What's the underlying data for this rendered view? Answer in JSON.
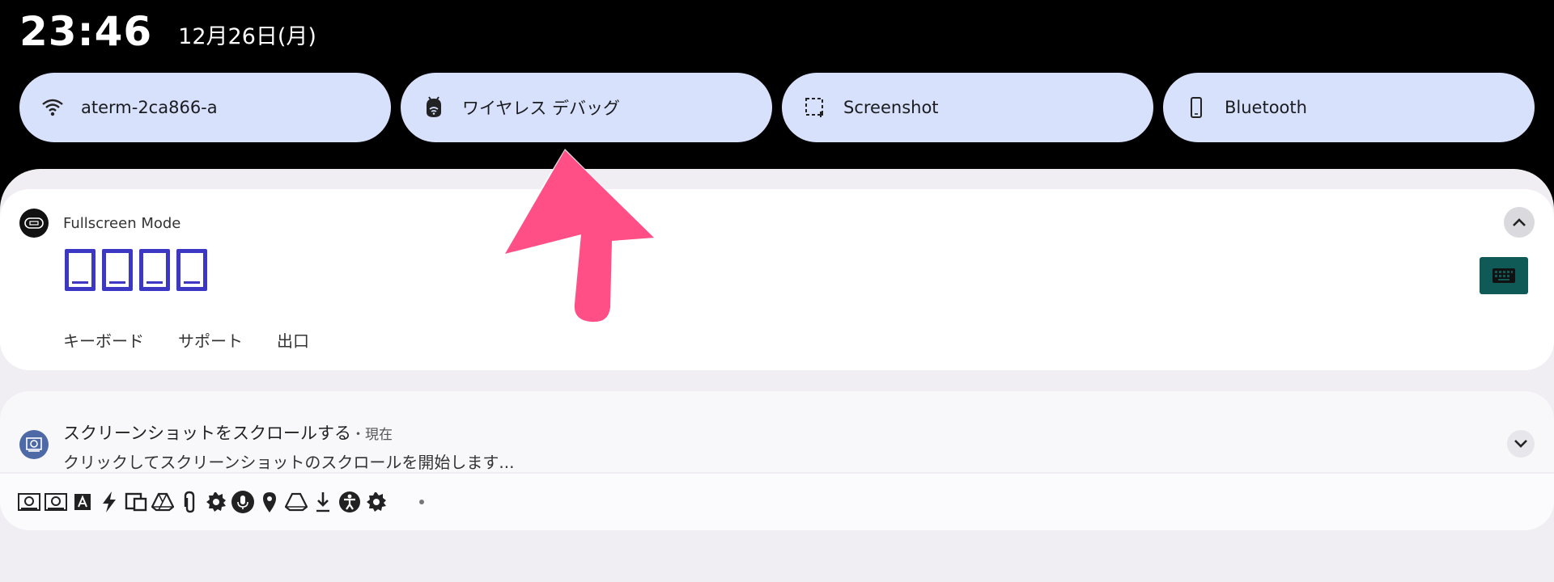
{
  "status": {
    "time": "23:46",
    "date": "12月26日(月)"
  },
  "tiles": [
    {
      "label": "aterm-2ca866-a",
      "icon": "wifi-icon"
    },
    {
      "label": "ワイヤレス デバッグ",
      "icon": "android-debug-icon"
    },
    {
      "label": "Screenshot",
      "icon": "screenshot-icon"
    },
    {
      "label": "Bluetooth",
      "icon": "phone-icon"
    }
  ],
  "notification1": {
    "app": "Fullscreen Mode",
    "icon": "fullscreen-mode-app-icon",
    "actions": [
      "キーボード",
      "サポート",
      "出口"
    ]
  },
  "notification2": {
    "title": "スクリーンショットをスクロールする",
    "time": "・現在",
    "body": "クリックしてスクリーンショットのスクロールを開始します..."
  },
  "colors": {
    "tile_bg": "#d8e1fb",
    "glyph": "#3d38c4",
    "keyboard_button": "#0f5a56",
    "arrow": "#ff4f86"
  },
  "status_icons": [
    "screenshot-app-icon",
    "screenshot-app-icon",
    "font-a-icon",
    "bolt-icon",
    "devices-icon",
    "drive-icon",
    "attachment-icon",
    "gear-icon",
    "mic-icon",
    "location-pin-icon",
    "drive-icon",
    "download-icon",
    "accessibility-icon",
    "gear-icon"
  ]
}
